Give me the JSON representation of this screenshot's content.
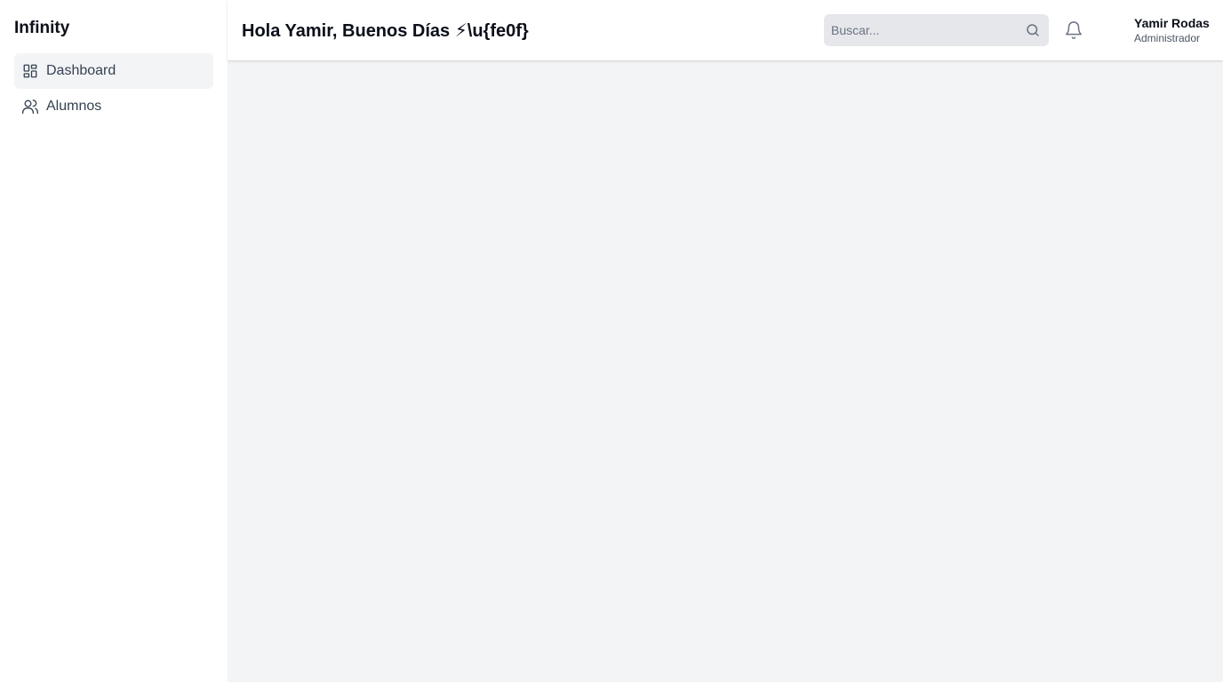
{
  "sidebar": {
    "brand": "Infinity",
    "items": [
      {
        "label": "Dashboard",
        "icon": "dashboard-grid-icon",
        "active": true
      },
      {
        "label": "Alumnos",
        "icon": "users-icon",
        "active": false
      }
    ]
  },
  "header": {
    "greeting": "Hola Yamir, Buenos Días ⚡\\u{fe0f}",
    "search": {
      "placeholder": "Buscar...",
      "value": "",
      "icon": "search-icon"
    },
    "notifications_icon": "bell-icon",
    "user": {
      "name": "Yamir Rodas",
      "role": "Administrador"
    }
  },
  "colors": {
    "sidebar_bg": "#ffffff",
    "content_bg": "#f3f4f6",
    "active_item_bg": "#f3f4f6",
    "search_bg": "#e5e7eb",
    "text_primary": "#0b0f19",
    "text_secondary": "#374151"
  }
}
